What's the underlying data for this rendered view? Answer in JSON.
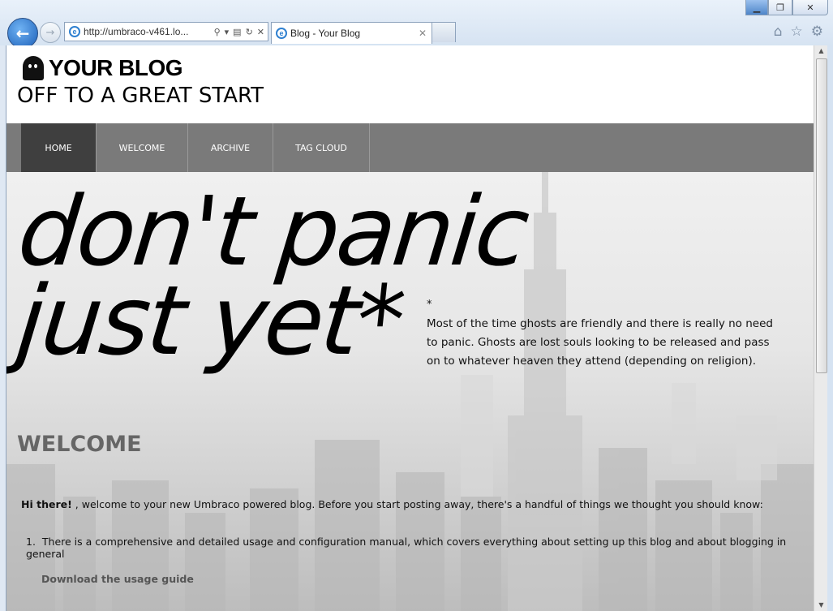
{
  "browser": {
    "url": "http://umbraco-v461.lo...",
    "tab_title": "Blog - Your Blog",
    "tab_close": "✕",
    "back_glyph": "←",
    "forward_glyph": "→",
    "icons": [
      "home-icon",
      "favorites-icon",
      "gear-icon"
    ]
  },
  "site": {
    "brand": "YOUR BLOG",
    "tagline": "OFF TO A GREAT START"
  },
  "nav": {
    "items": [
      {
        "label": "HOME",
        "active": true
      },
      {
        "label": "WELCOME",
        "active": false
      },
      {
        "label": "ARCHIVE",
        "active": false
      },
      {
        "label": "TAG CLOUD",
        "active": false
      }
    ]
  },
  "hero": {
    "line1": "don't panic",
    "line2": "just yet*",
    "star": "*",
    "note": "Most of the time ghosts are friendly and there is really no need to panic. Ghosts are lost souls looking to be released and pass on to whatever heaven they attend (depending on religion)."
  },
  "content": {
    "heading": "WELCOME",
    "intro_bold": "Hi there!",
    "intro_rest": " , welcome to your new Umbraco powered blog. Before you start posting away, there's a handful of things we thought you should know:",
    "list_number": "1.",
    "list_item": "There is a comprehensive and detailed usage and configuration manual, which covers everything about setting up this blog and about blogging in general",
    "download_link": "Download the usage guide"
  }
}
